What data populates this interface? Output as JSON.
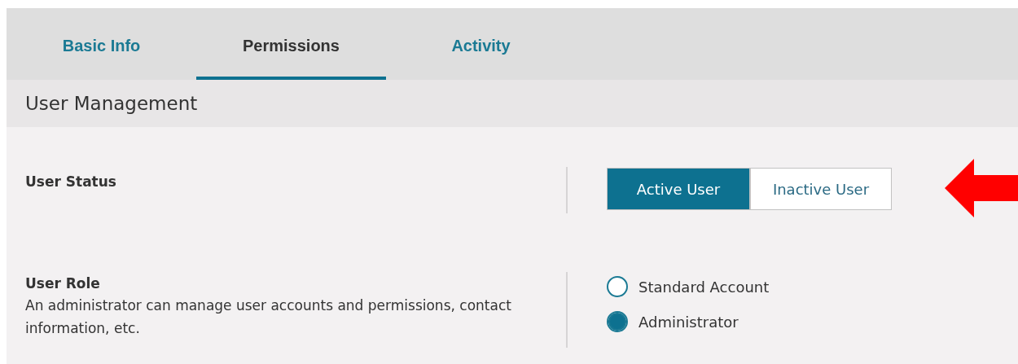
{
  "tabs": [
    {
      "label": "Basic Info",
      "selected": false
    },
    {
      "label": "Permissions",
      "selected": true
    },
    {
      "label": "Activity",
      "selected": false
    }
  ],
  "section": {
    "title": "User Management"
  },
  "user_status": {
    "label": "User Status",
    "options": [
      {
        "label": "Active User",
        "selected": true
      },
      {
        "label": "Inactive User",
        "selected": false
      }
    ]
  },
  "user_role": {
    "label": "User Role",
    "description": "An administrator can manage user accounts and permissions, contact information, etc.",
    "options": [
      {
        "label": "Standard Account",
        "selected": false
      },
      {
        "label": "Administrator",
        "selected": true
      }
    ]
  },
  "annotation": {
    "kind": "arrow"
  }
}
